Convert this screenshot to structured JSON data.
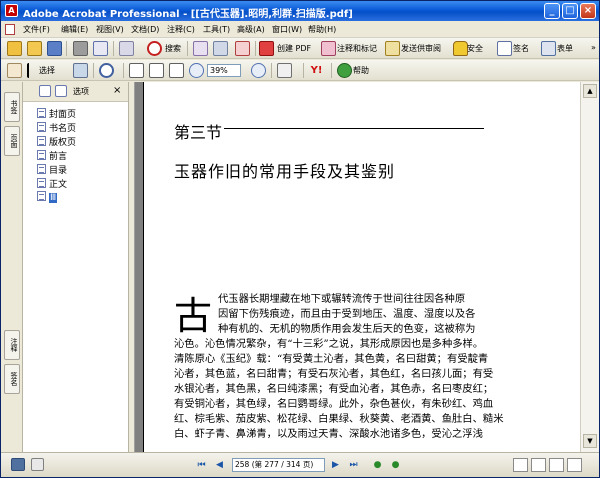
{
  "window": {
    "title": "Adobe Acrobat Professional - [[古代玉器].昭明,利群.扫描版.pdf]",
    "controls": [
      "minimize",
      "maximize",
      "close"
    ]
  },
  "menubar": {
    "items": [
      "文件(F)",
      "编辑(E)",
      "视图(V)",
      "文档(D)",
      "注释(C)",
      "工具(T)",
      "高级(A)",
      "窗口(W)",
      "帮助(H)"
    ]
  },
  "toolbar1": {
    "search_label": "搜索",
    "create_pdf_label": "创建 PDF",
    "comment_label": "注释和标记",
    "review_label": "发送供审阅",
    "secure_label": "安全",
    "sign_label": "签名",
    "forms_label": "表单"
  },
  "toolbar2": {
    "select_label": "选择",
    "zoom_value": "39%",
    "help_label": "帮助"
  },
  "nav_tabs": [
    "书签",
    "页面",
    "注释",
    "签名"
  ],
  "bookmarks": {
    "options_label": "选项",
    "items": [
      "封面页",
      "书名页",
      "版权页",
      "前言",
      "目录",
      "正文",
      "Ⅲ"
    ]
  },
  "document": {
    "section": "第三节",
    "heading": "玉器作旧的常用手段及其鉴别",
    "dropcap": "古",
    "lines": [
      "代玉器长期埋藏在地下或辗转流传于世间往往因各种原",
      "因留下伤残痕迹，而且由于受到地压、温度、湿度以及各",
      "种有机的、无机的物质作用会发生后天的色变，这被称为",
      "沁色。沁色情况繁杂，有“十三彩”之说，其形成原因也是多种多样。",
      "清陈原心《玉纪》载：“有受黄土沁者，其色黄，名曰甜黄；有受靛青",
      "沁者，其色蓝，名曰甜青；有受石灰沁者，其色红，名曰孩儿面；有受",
      "水银沁者，其色黑，名曰纯漆黑；有受血沁者，其色赤，名曰枣皮红；",
      "有受铜沁者，其色绿，名曰鹦哥绿。此外，杂色甚伙，有朱砂红、鸡血",
      "红、棕毛紫、茄皮紫、松花绿、白果绿、秋葵黄、老酒黄、鱼肚白、糙米",
      "白、虾子青、鼻涕青，以及雨过天青、深酸水池诸多色，受沁之浮浅"
    ]
  },
  "statusbar": {
    "page_value": "258 (第 277 / 314 页)"
  }
}
